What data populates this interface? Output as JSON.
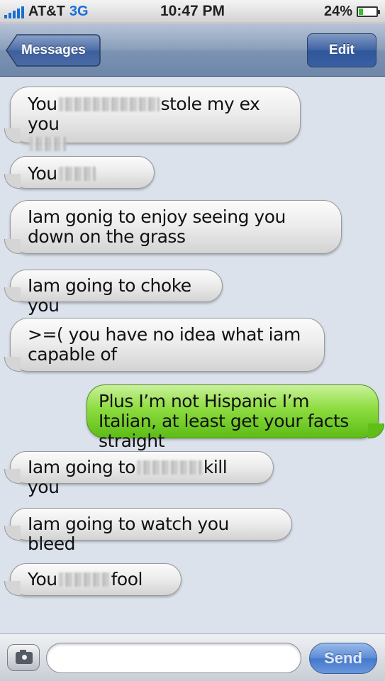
{
  "status": {
    "carrier": "AT&T",
    "network": "3G",
    "time": "10:47 PM",
    "battery": "24%",
    "battery_level": 0.24
  },
  "nav": {
    "back_label": "Messages",
    "edit_label": "Edit"
  },
  "messages": [
    {
      "from": "them",
      "parts": [
        "You",
        "[blurred]",
        "stole my ex you",
        "[blurred]"
      ]
    },
    {
      "from": "them",
      "parts": [
        "You",
        "[blurred]"
      ]
    },
    {
      "from": "them",
      "text": "Iam gonig to enjoy seeing you down on the grass"
    },
    {
      "from": "them",
      "text": "Iam going to choke you"
    },
    {
      "from": "them",
      "text": ">=( you have no idea what iam capable of"
    },
    {
      "from": "me",
      "text": "Plus I’m not Hispanic I’m Italian, at least get your facts straight"
    },
    {
      "from": "them",
      "parts": [
        "Iam going to",
        "[blurred]",
        "kill you"
      ]
    },
    {
      "from": "them",
      "text": "Iam going to watch you bleed"
    },
    {
      "from": "them",
      "parts": [
        "You",
        "[blurred]",
        "fool"
      ]
    }
  ],
  "composer": {
    "placeholder": "",
    "value": "",
    "send_label": "Send",
    "camera_icon": "camera-icon"
  },
  "colors": {
    "sent_bubble": "#7ed23a",
    "received_bubble": "#e6e6e6",
    "nav_bar": "#7c93b3",
    "background": "#dbe2ec"
  }
}
